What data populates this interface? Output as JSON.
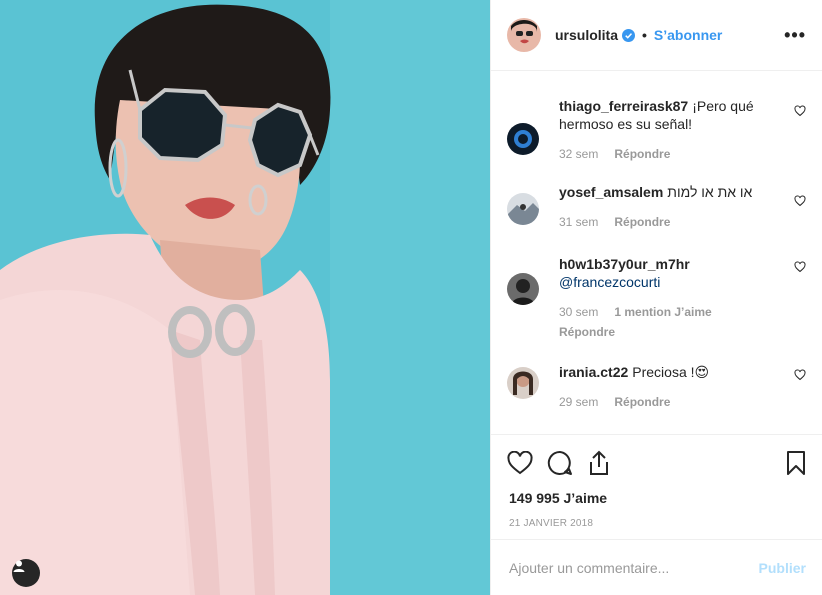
{
  "post": {
    "username": "ursulolita",
    "follow_label": "S’abonner",
    "more_label": "•••",
    "likes_text": "149 995 J’aime",
    "date_text": "21 janvier 2018",
    "comment_placeholder": "Ajouter un commentaire...",
    "publish_label": "Publier"
  },
  "comments": [
    {
      "user": "thiago_ferreirask87",
      "text": "¡Pero qué hermoso es su señal!",
      "time": "32 sem",
      "reply": "Répondre"
    },
    {
      "user": "yosef_amsalem",
      "text": "או את או למות",
      "time": "31 sem",
      "reply": "Répondre"
    },
    {
      "user": "h0w1b37y0ur_m7hr",
      "mention": "@francezcocurti",
      "time": "30 sem",
      "likes": "1 mention J’aime",
      "reply": "Répondre"
    },
    {
      "user": "irania.ct22",
      "text": "Preciosa !",
      "emoji": "😍",
      "time": "29 sem",
      "reply": "Répondre"
    }
  ],
  "colors": {
    "accent": "#3897f0",
    "photo_bg": "#5ac3d3",
    "publish_disabled": "#b2dffc"
  },
  "icons": [
    "heart-icon",
    "comment-icon",
    "share-icon",
    "bookmark-icon",
    "user-tag-icon",
    "verified-badge-icon"
  ]
}
